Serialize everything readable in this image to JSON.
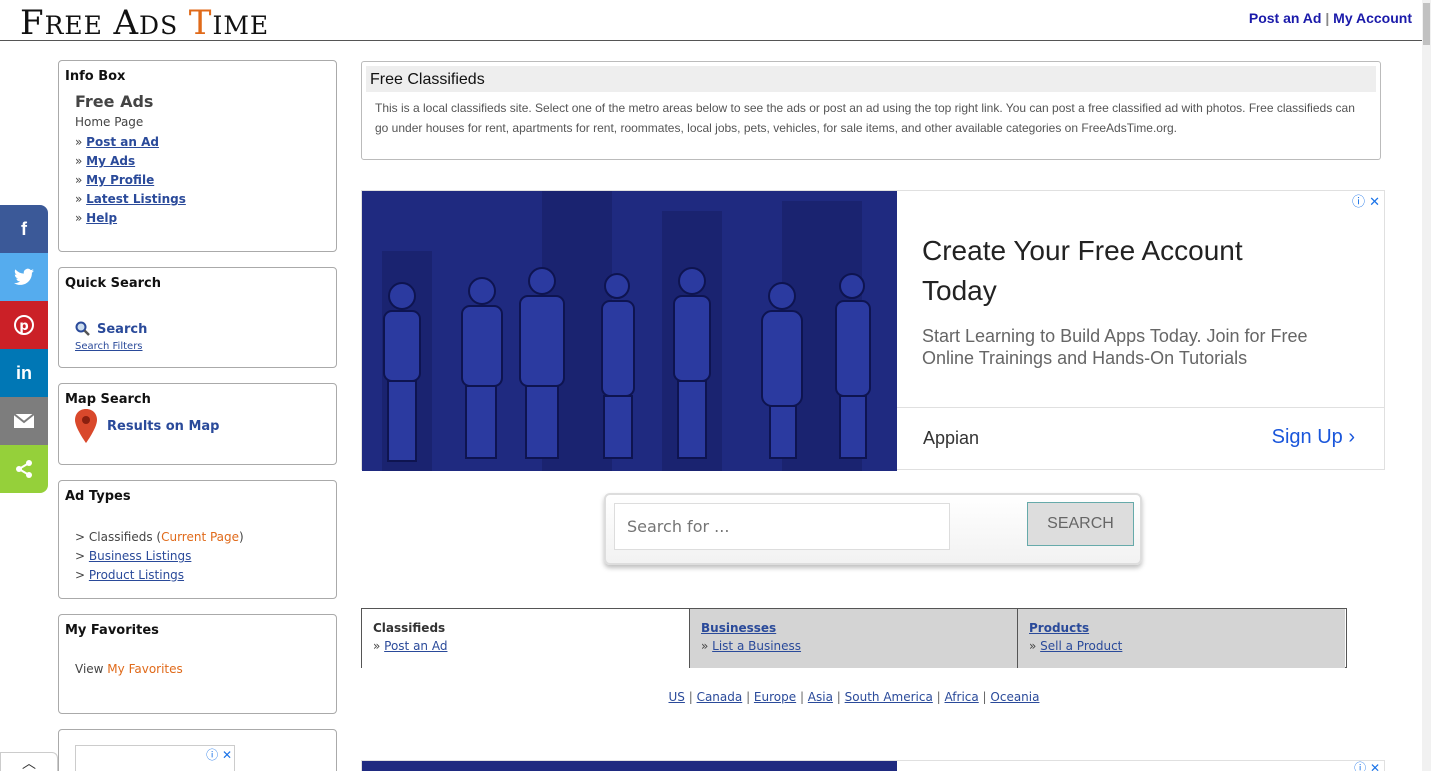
{
  "header": {
    "logo": {
      "f": "F",
      "ree": "REE",
      "a": "A",
      "ds": "DS",
      "t": "T",
      "ime": "IME"
    },
    "post_ad": "Post an Ad",
    "separator": "|",
    "my_account": "My Account"
  },
  "share": [
    "facebook",
    "twitter",
    "pinterest",
    "linkedin",
    "email",
    "share"
  ],
  "info_box": {
    "title": "Info Box",
    "subtitle": "Free Ads",
    "home": "Home Page",
    "links": [
      "Post an Ad",
      "My Ads",
      "My Profile",
      "Latest Listings",
      "Help"
    ]
  },
  "quick_search": {
    "title": "Quick Search",
    "search": "Search",
    "filters": "Search Filters"
  },
  "map_search": {
    "title": "Map Search",
    "link": "Results on Map"
  },
  "ad_types": {
    "title": "Ad Types",
    "classifieds": "Classifieds (",
    "current": "Current Page",
    "close_paren": ")",
    "business": "Business Listings",
    "product": "Product Listings"
  },
  "favorites": {
    "title": "My Favorites",
    "view": "View ",
    "link": "My Favorites"
  },
  "classifieds_box": {
    "title": "Free Classifieds",
    "text": "This is a local classifieds site. Select one of the metro areas below to see the ads or post an ad using the top right link. You can post a free classified ad with photos. Free classifieds can go under houses for rent, apartments for rent, roommates, local jobs, pets, vehicles, for sale items, and other available categories on FreeAdsTime.org."
  },
  "ad": {
    "headline": "Create Your Free Account Today",
    "description": "Start Learning to Build Apps Today. Join for Free Online Trainings and Hands-On Tutorials",
    "advertiser": "Appian",
    "cta": "Sign Up"
  },
  "search": {
    "placeholder": "Search for ...",
    "button": "SEARCH"
  },
  "tabs": [
    {
      "title": "Classifieds",
      "link": "Post an Ad"
    },
    {
      "title": "Businesses",
      "link": "List a Business"
    },
    {
      "title": "Products",
      "link": "Sell a Product"
    }
  ],
  "regions": [
    "US",
    "Canada",
    "Europe",
    "Asia",
    "South America",
    "Africa",
    "Oceania"
  ],
  "colors": {
    "accent": "#e06a1a",
    "link": "#2a4a9a",
    "ad_bg": "#1f2a80"
  }
}
